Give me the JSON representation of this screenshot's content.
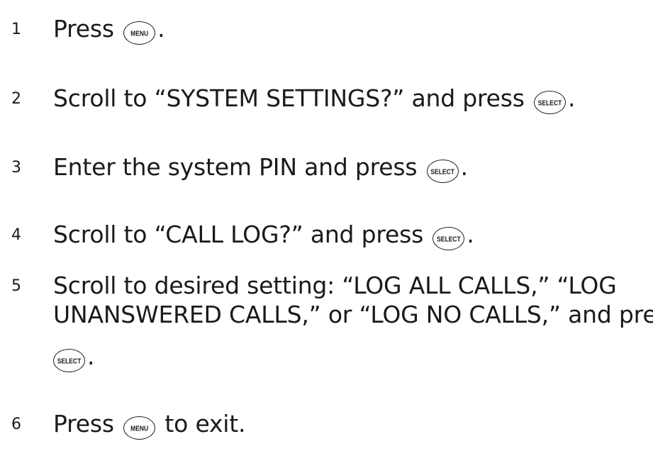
{
  "steps": [
    {
      "number": "1",
      "before": "Press ",
      "key": "MENU",
      "after": "."
    },
    {
      "number": "2",
      "before": "Scroll to “SYSTEM SETTINGS?” and press ",
      "key": "SELECT",
      "after": "."
    },
    {
      "number": "3",
      "before": "Enter the system PIN and press ",
      "key": "SELECT",
      "after": "."
    },
    {
      "number": "4",
      "before": "Scroll to “CALL LOG?” and press ",
      "key": "SELECT",
      "after": "."
    },
    {
      "number": "5",
      "line1": "Scroll to desired setting: “LOG ALL CALLS,” “LOG",
      "line2": "UNANSWERED CALLS,” or “LOG NO CALLS,” and press",
      "key": "SELECT",
      "after": "."
    },
    {
      "number": "6",
      "before": "Press ",
      "key": "MENU",
      "after": " to exit."
    }
  ]
}
